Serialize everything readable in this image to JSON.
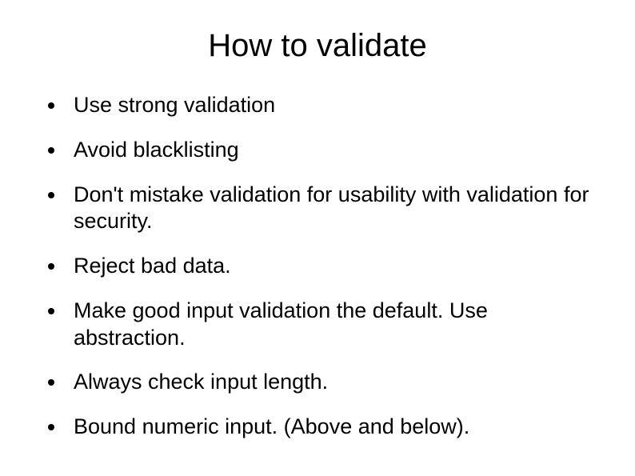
{
  "slide": {
    "title": "How to validate",
    "bullets": [
      "Use strong validation",
      "Avoid blacklisting",
      "Don't mistake validation for usability with validation for security.",
      "Reject bad data.",
      "Make good input validation the default. Use abstraction.",
      "Always check input length.",
      "Bound numeric input. (Above and below)."
    ]
  }
}
